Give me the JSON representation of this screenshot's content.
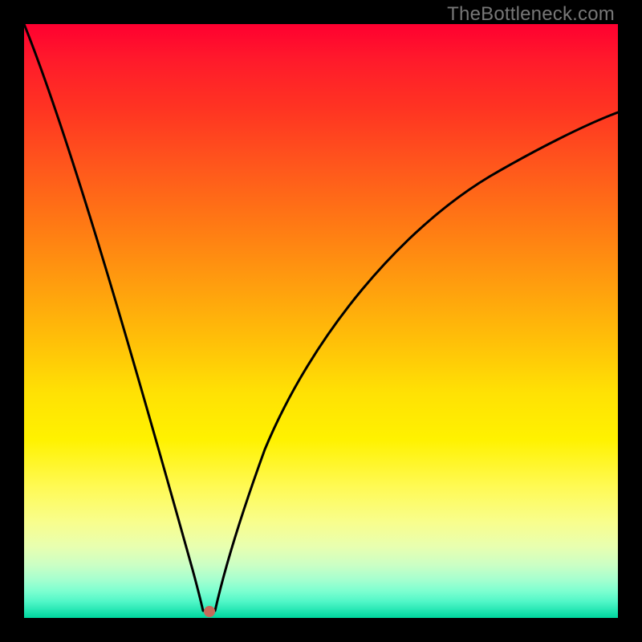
{
  "watermark": "TheBottleneck.com",
  "chart_data": {
    "type": "line",
    "title": "",
    "xlabel": "",
    "ylabel": "",
    "xlim": [
      0,
      100
    ],
    "ylim": [
      0,
      100
    ],
    "grid": false,
    "series": [
      {
        "name": "bottleneck-curve",
        "x": [
          0,
          4,
          8,
          12,
          16,
          20,
          24,
          27,
          29.5,
          30.5,
          31.5,
          33,
          36,
          40,
          45,
          50,
          56,
          62,
          70,
          78,
          86,
          94,
          100
        ],
        "y": [
          100,
          87,
          74,
          61,
          48,
          35,
          22,
          11,
          3,
          1,
          1,
          3,
          12,
          24,
          36,
          46,
          55,
          62,
          70,
          76,
          81,
          85,
          88
        ]
      }
    ],
    "marker": {
      "x": 31.2,
      "y": 1
    },
    "gradient_stops": [
      {
        "pos": 0,
        "color": "#ff0030"
      },
      {
        "pos": 50,
        "color": "#ffca00"
      },
      {
        "pos": 80,
        "color": "#fffa55"
      },
      {
        "pos": 100,
        "color": "#00d69e"
      }
    ]
  }
}
